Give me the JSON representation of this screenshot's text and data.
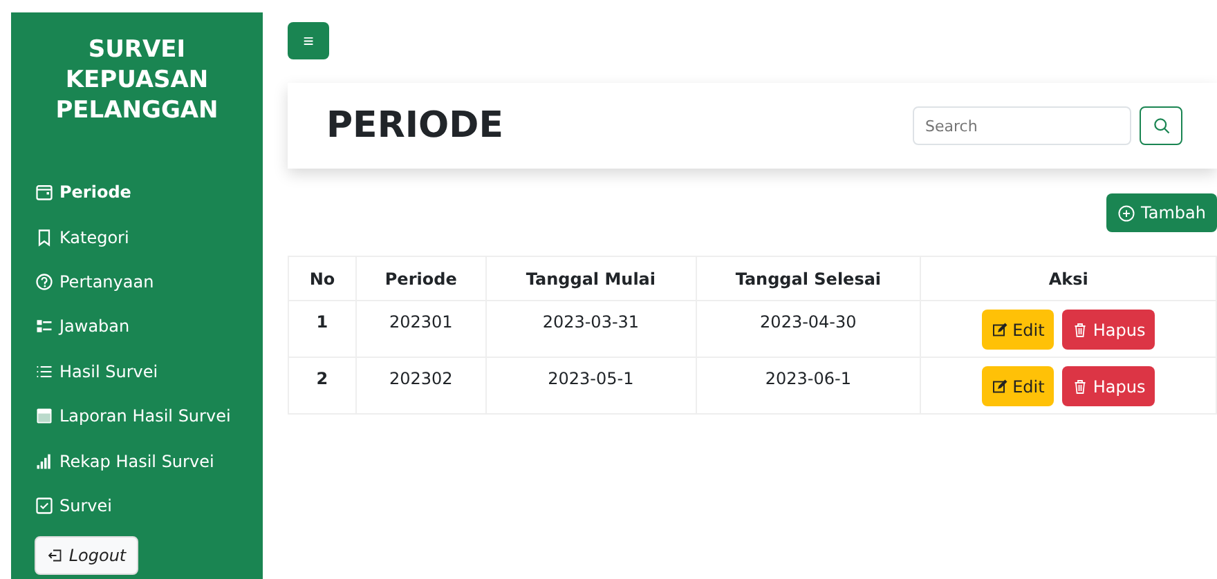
{
  "sidebar": {
    "title": "SURVEI KEPUASAN PELANGGAN",
    "items": [
      {
        "label": "Periode",
        "selected": true
      },
      {
        "label": "Kategori",
        "selected": false
      },
      {
        "label": "Pertanyaan",
        "selected": false
      },
      {
        "label": "Jawaban",
        "selected": false
      },
      {
        "label": "Hasil Survei",
        "selected": false
      },
      {
        "label": "Laporan Hasil Survei",
        "selected": false
      },
      {
        "label": "Rekap Hasil Survei",
        "selected": false
      },
      {
        "label": "Survei",
        "selected": false
      }
    ],
    "logout": "Logout"
  },
  "menu_button": "≡",
  "header": {
    "title": "PERIODE",
    "search": {
      "placeholder": "Search"
    }
  },
  "add_button": "Tambah",
  "table": {
    "columns": [
      "No",
      "Periode",
      "Tanggal Mulai",
      "Tanggal Selesai",
      "Aksi"
    ],
    "rows": [
      {
        "no": "1",
        "periode": "202301",
        "mulai": "2023-03-31",
        "selesai": "2023-04-30",
        "actions": [
          {
            "kind": "edit",
            "label": "Edit"
          },
          {
            "kind": "delete",
            "label": "Hapus"
          }
        ]
      },
      {
        "no": "2",
        "periode": "202302",
        "mulai": "2023-05-1",
        "selesai": "2023-06-1",
        "actions": [
          {
            "kind": "edit",
            "label": "Edit"
          },
          {
            "kind": "delete",
            "label": "Hapus"
          }
        ]
      }
    ]
  }
}
